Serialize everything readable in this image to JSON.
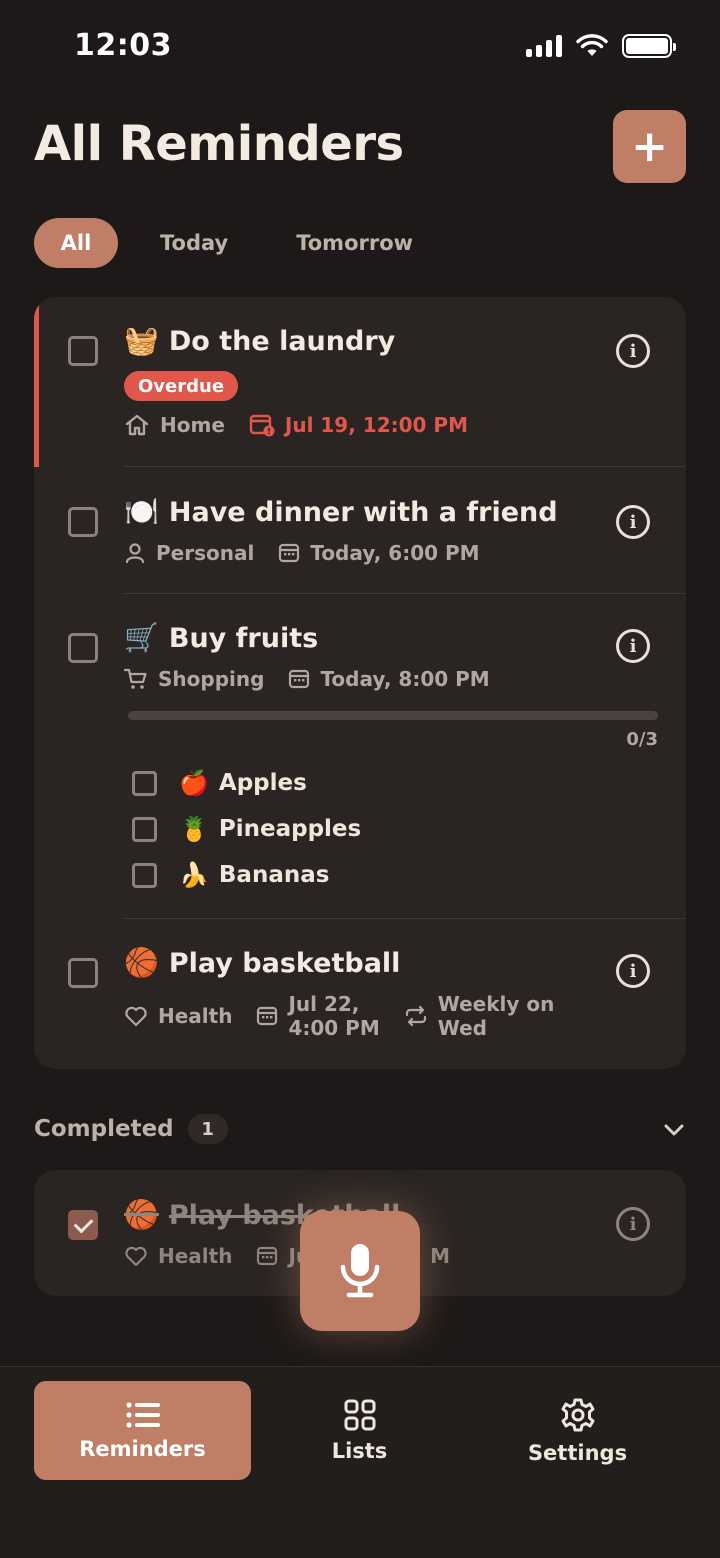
{
  "status_bar": {
    "time": "12:03"
  },
  "header": {
    "title": "All Reminders",
    "add_label": "+"
  },
  "filters": [
    {
      "label": "All",
      "active": true
    },
    {
      "label": "Today",
      "active": false
    },
    {
      "label": "Tomorrow",
      "active": false
    }
  ],
  "reminders": [
    {
      "emoji": "🧺",
      "title": "Do the laundry",
      "badge": "Overdue",
      "list": "Home",
      "list_icon": "home-icon",
      "due": "Jul 19, 12:00 PM",
      "due_overdue": true
    },
    {
      "emoji": "🍽️",
      "title": "Have dinner with a friend",
      "list": "Personal",
      "list_icon": "person-icon",
      "due": "Today, 6:00 PM"
    },
    {
      "emoji": "🛒",
      "title": "Buy fruits",
      "list": "Shopping",
      "list_icon": "cart-icon",
      "due": "Today, 8:00 PM",
      "progress": {
        "label": "0/3",
        "done": 0,
        "total": 3
      },
      "subtasks": [
        {
          "emoji": "🍎",
          "label": "Apples"
        },
        {
          "emoji": "🍍",
          "label": "Pineapples"
        },
        {
          "emoji": "🍌",
          "label": "Bananas"
        }
      ]
    },
    {
      "emoji": "🏀",
      "title": "Play basketball",
      "list": "Health",
      "list_icon": "heart-icon",
      "due_line1": "Jul 22,",
      "due_line2": "4:00 PM",
      "repeat_line1": "Weekly on",
      "repeat_line2": "Wed"
    }
  ],
  "completed": {
    "label": "Completed",
    "count": "1",
    "items": [
      {
        "emoji": "🏀",
        "title": "Play basketball",
        "list": "Health",
        "due_partial_left": "Ju",
        "due_partial_right": "M"
      }
    ]
  },
  "tab_bar": [
    {
      "label": "Reminders",
      "icon": "list-icon",
      "active": true
    },
    {
      "label": "Lists",
      "icon": "grid-icon",
      "active": false
    },
    {
      "label": "Settings",
      "icon": "gear-icon",
      "active": false
    }
  ],
  "colors": {
    "background": "#1c1918",
    "card": "#2a2522",
    "accent": "#c07e66",
    "overdue": "#e2574c",
    "muted_text": "#b2a79e"
  }
}
